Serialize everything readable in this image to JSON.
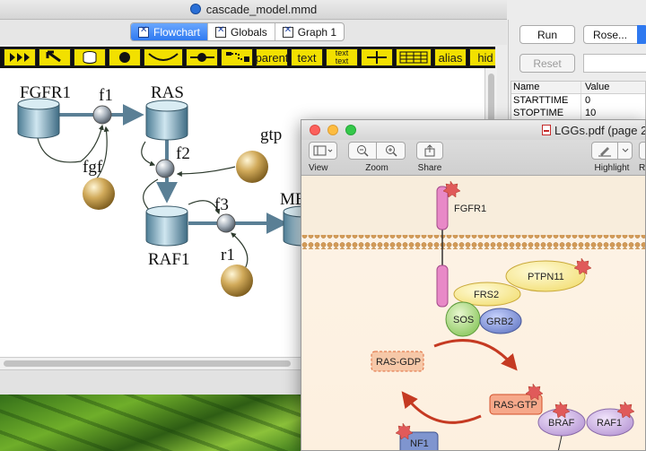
{
  "window": {
    "title": "cascade_model.mmd"
  },
  "tabs": [
    {
      "label": "Flowchart",
      "active": true
    },
    {
      "label": "Globals",
      "active": false
    },
    {
      "label": "Graph 1",
      "active": false
    }
  ],
  "toolbar": {
    "parent": "parent",
    "text": "text",
    "text_stack_top": "text",
    "text_stack_bottom": "text",
    "alias": "alias",
    "hide": "hid"
  },
  "diagram": {
    "nodes": {
      "fgfr1": "FGFR1",
      "ras": "RAS",
      "raf1": "RAF1",
      "mek": "ME",
      "f1": "f1",
      "f2": "f2",
      "f3": "f3",
      "fgf": "fgf",
      "gtp": "gtp",
      "r1": "r1"
    }
  },
  "sidepanel": {
    "run": "Run",
    "reset": "Reset",
    "method": "Rose...",
    "table_headers": [
      "Name",
      "Value"
    ],
    "rows": [
      {
        "name": "STARTTIME",
        "value": "0"
      },
      {
        "name": "STOPTIME",
        "value": "10"
      }
    ]
  },
  "preview": {
    "title": "LGGs.pdf (page 2",
    "toolbar": {
      "view": "View",
      "zoom": "Zoom",
      "share": "Share",
      "highlight": "Highlight",
      "rotate_partial": "R"
    },
    "pathway": {
      "fgfr1": "FGFR1",
      "ptpn11": "PTPN11",
      "frs2": "FRS2",
      "sos": "SOS",
      "grb2": "GRB2",
      "ras_gdp": "RAS-GDP",
      "ras_gtp": "RAS-GTP",
      "braf": "BRAF",
      "raf1": "RAF1",
      "nf1": "NF1"
    }
  },
  "colors": {
    "active_tab": "#2f79f0",
    "toolbar_button": "#f2e000",
    "toolbar_bg": "#111111",
    "membrane": "#e0b57a"
  }
}
